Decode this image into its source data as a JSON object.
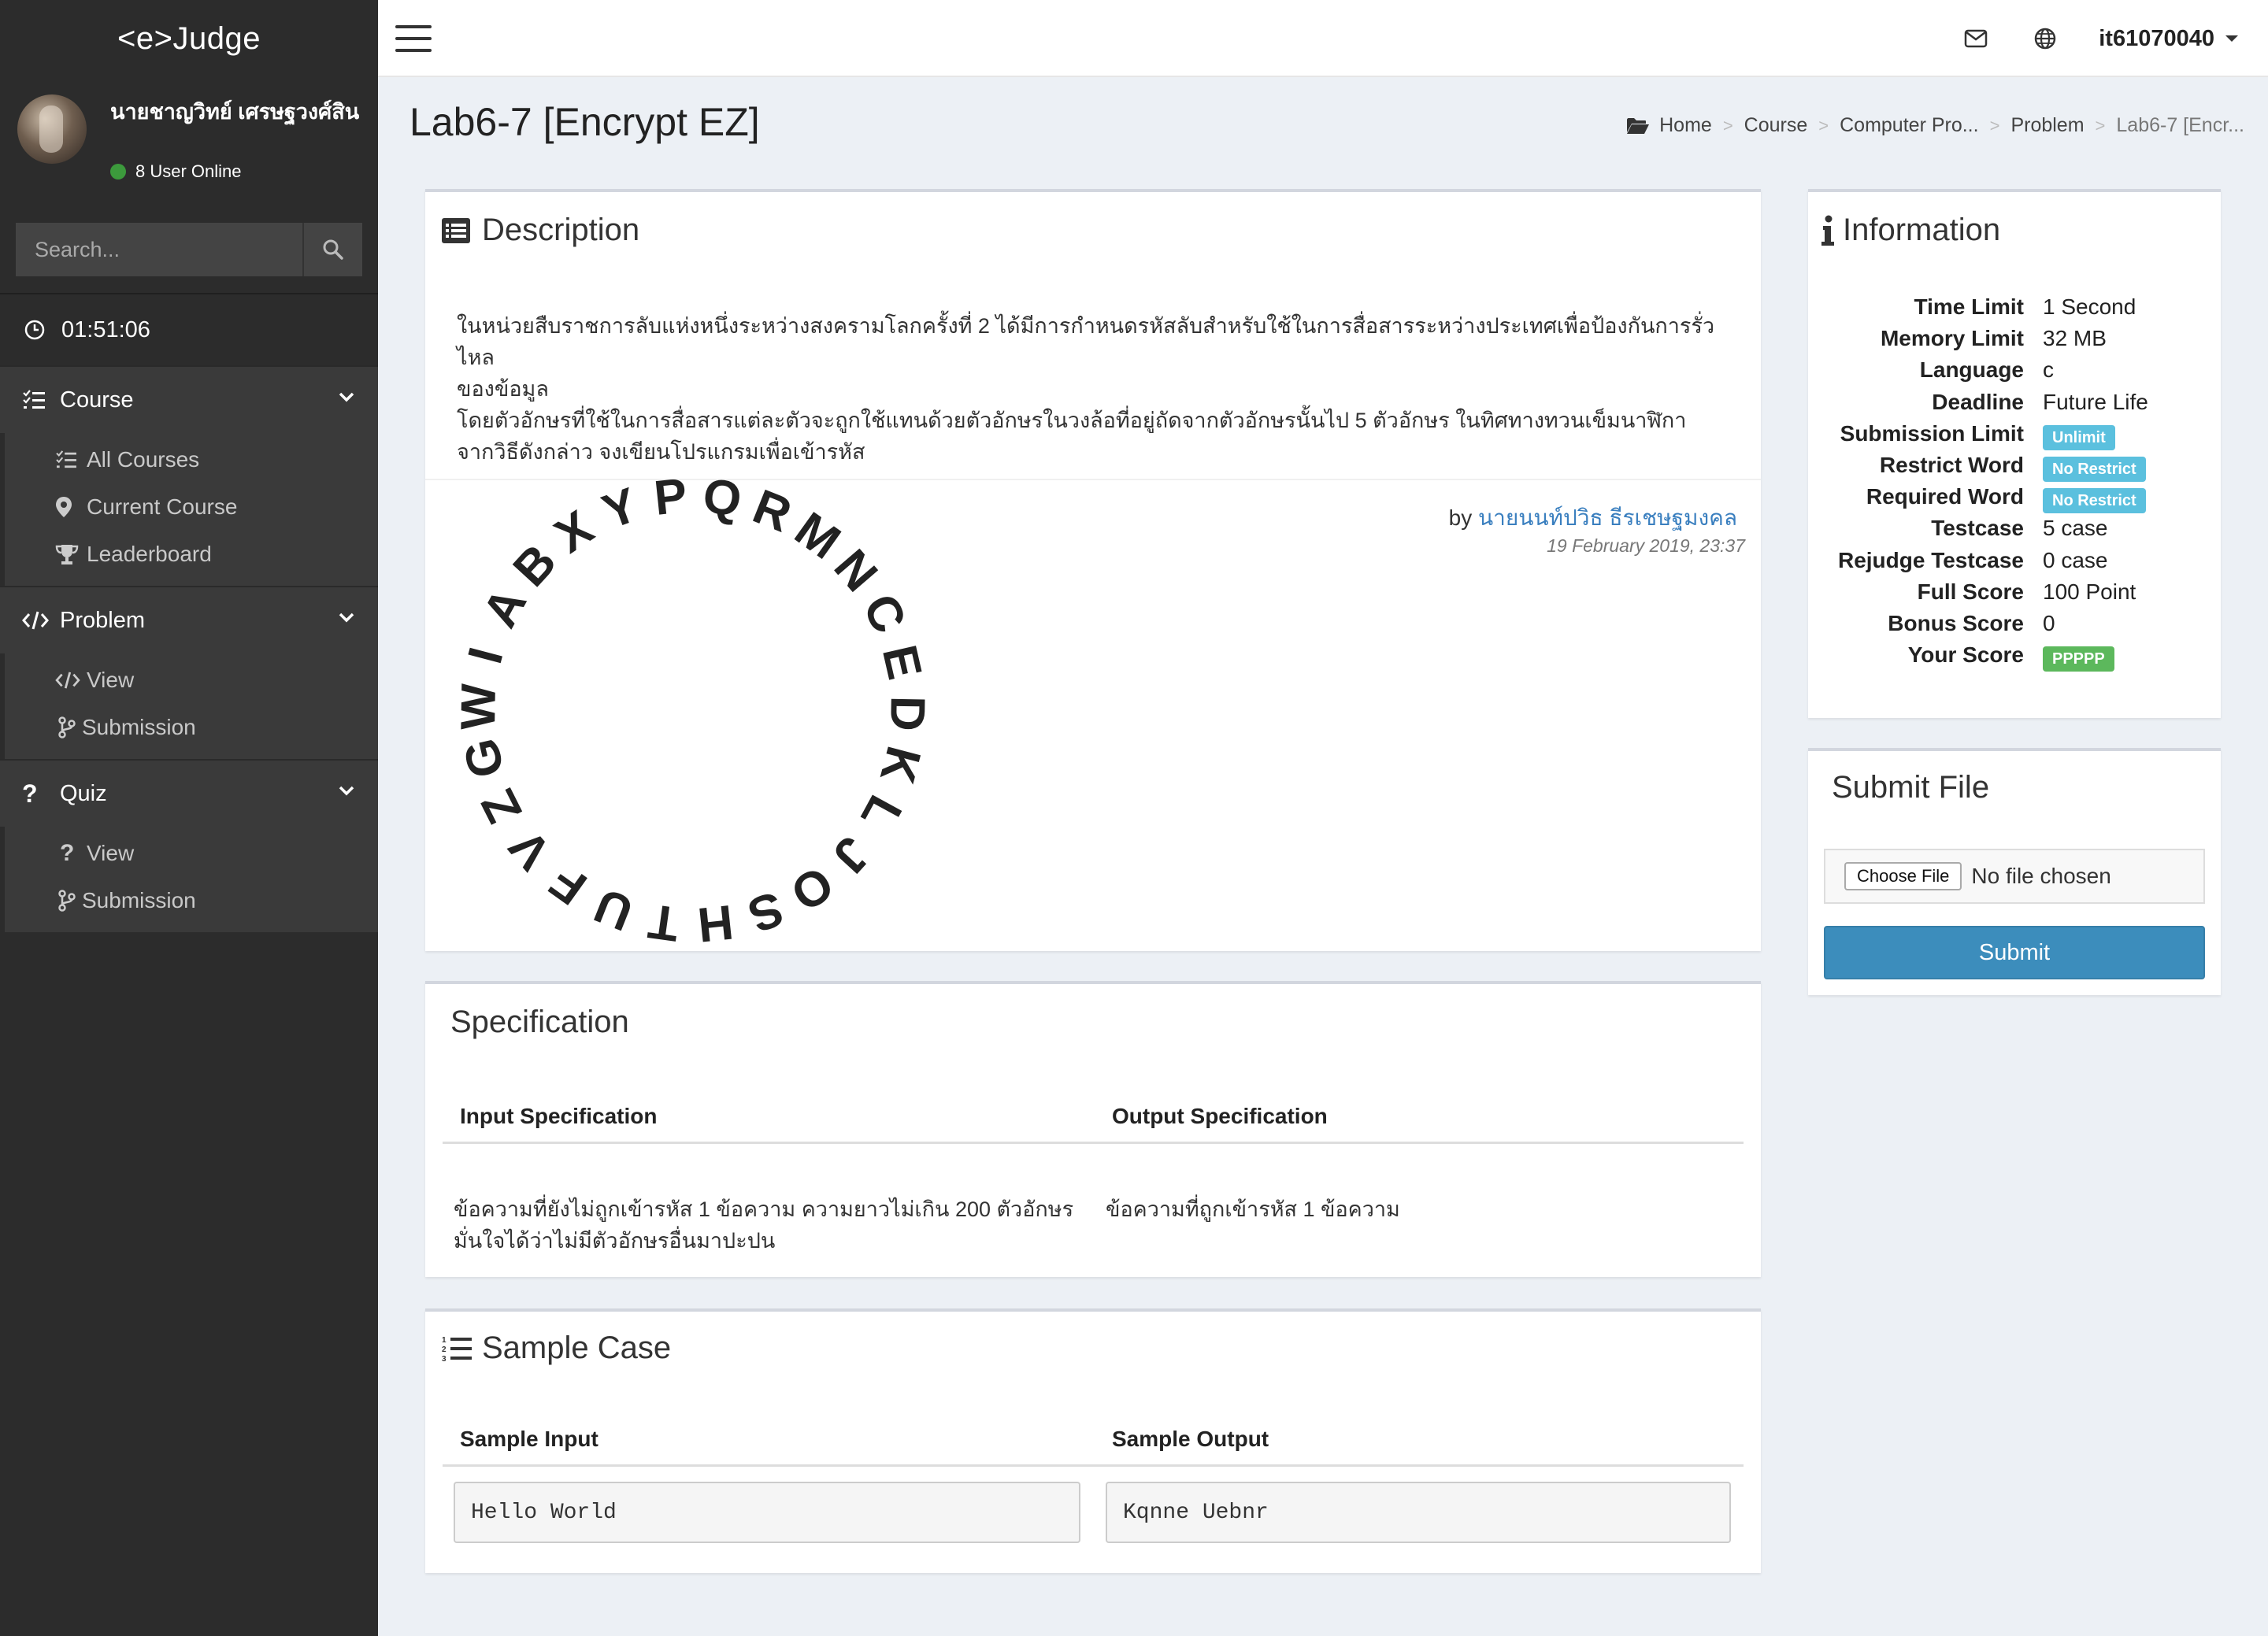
{
  "sidebar": {
    "brand": "<e>Judge",
    "user_name": "นายชาญวิทย์ เศรษฐวงศ์สิน",
    "online_text": "8 User Online",
    "search_placeholder": "Search...",
    "clock": "01:51:06",
    "sections": [
      {
        "label": "Course",
        "items": [
          "All Courses",
          "Current Course",
          "Leaderboard"
        ]
      },
      {
        "label": "Problem",
        "items": [
          "View",
          "Submission"
        ]
      },
      {
        "label": "Quiz",
        "items": [
          "View",
          "Submission"
        ]
      }
    ]
  },
  "topbar": {
    "username": "it61070040"
  },
  "header": {
    "title": "Lab6-7 [Encrypt EZ]",
    "breadcrumb": [
      "Home",
      "Course",
      "Computer Pro...",
      "Problem",
      "Lab6-7 [Encr..."
    ]
  },
  "description": {
    "title": "Description",
    "line1": "ในหน่วยสืบราชการลับแห่งหนึ่งระหว่างสงครามโลกครั้งที่ 2 ได้มีการกำหนดรหัสลับสำหรับใช้ในการสื่อสารระหว่างประเทศเพื่อป้องกันการรั่วไหล",
    "line2": "ของข้อมูล",
    "line3": "โดยตัวอักษรที่ใช้ในการสื่อสารแต่ละตัวจะถูกใช้แทนด้วยตัวอักษรในวงล้อที่อยู่ถัดจากตัวอักษรนั้นไป 5 ตัวอักษร ในทิศทางทวนเข็มนาฬิกา",
    "line4": "จากวิธีดังกล่าว จงเขียนโปรแกรมเพื่อเข้ารหัส",
    "wheel_letters": "PQRMNCEDKLJOSHTUFVZGWIABXY",
    "by_prefix": "by",
    "author": "นายนนท์ปวิธ ธีรเชษฐมงคล",
    "date": "19 February 2019, 23:37"
  },
  "specification": {
    "title": "Specification",
    "input_header": "Input Specification",
    "output_header": "Output Specification",
    "input_line1": "ข้อความที่ยังไม่ถูกเข้ารหัส 1 ข้อความ ความยาวไม่เกิน 200 ตัวอักษร",
    "input_line2": "มั่นใจได้ว่าไม่มีตัวอักษรอื่นมาปะปน",
    "output_text": "ข้อความที่ถูกเข้ารหัส 1 ข้อความ"
  },
  "sample": {
    "title": "Sample Case",
    "input_header": "Sample Input",
    "output_header": "Sample Output",
    "input_value": "Hello World",
    "output_value": "Kqnne Uebnr"
  },
  "information": {
    "title": "Information",
    "rows": [
      {
        "label": "Time Limit",
        "value": "1 Second"
      },
      {
        "label": "Memory Limit",
        "value": "32 MB"
      },
      {
        "label": "Language",
        "value": "c"
      },
      {
        "label": "Deadline",
        "value": "Future Life"
      },
      {
        "label": "Submission Limit",
        "value": "Unlimit",
        "badge": "blue"
      },
      {
        "label": "Restrict Word",
        "value": "No Restrict",
        "badge": "blue"
      },
      {
        "label": "Required Word",
        "value": "No Restrict",
        "badge": "blue"
      },
      {
        "label": "Testcase",
        "value": "5 case"
      },
      {
        "label": "Rejudge Testcase",
        "value": "0 case"
      },
      {
        "label": "Full Score",
        "value": "100 Point"
      },
      {
        "label": "Bonus Score",
        "value": "0"
      },
      {
        "label": "Your Score",
        "value": "PPPPP",
        "badge": "green"
      }
    ]
  },
  "submit": {
    "title": "Submit File",
    "choose_label": "Choose File",
    "no_file": "No file chosen",
    "button": "Submit"
  },
  "colors": {
    "sidebar": "#2c2c2c",
    "primary": "#3c8dbc",
    "info_badge": "#5bc0de",
    "success_badge": "#5cb85c",
    "link": "#3a7fbf"
  }
}
